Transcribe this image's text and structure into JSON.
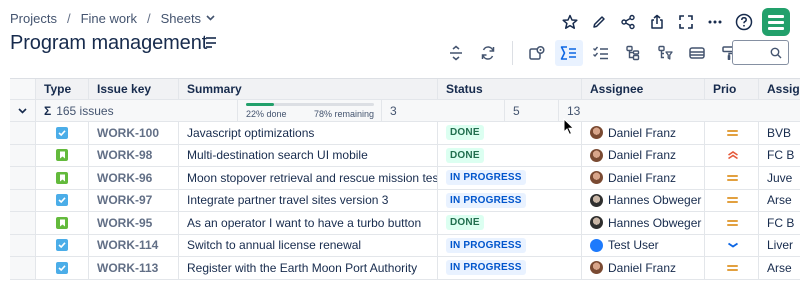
{
  "breadcrumb": {
    "items": [
      "Projects",
      "Fine work",
      "Sheets"
    ]
  },
  "page": {
    "title": "Program management"
  },
  "top_icons": [
    "star-icon",
    "pencil-icon",
    "share-icon",
    "export-icon",
    "fullscreen-icon",
    "more-icon",
    "help-icon",
    "app-logo-icon"
  ],
  "toolbar": {
    "icons": [
      "row-height-icon",
      "refresh-icon",
      "view-icon",
      "sum-icon",
      "checklist-icon",
      "hierarchy-icon",
      "hierarchy-filter-icon",
      "card-icon",
      "format-paint-icon"
    ],
    "search_placeholder": ""
  },
  "table": {
    "columns": [
      "Type",
      "Issue key",
      "Summary",
      "Status",
      "Assignee",
      "Prio",
      "Assig"
    ],
    "summary_row": {
      "count_label": "165 issues",
      "progress_done_label": "22% done",
      "progress_remaining_label": "78% remaining",
      "progress_done_fraction": 0.22,
      "assignee_count": "3",
      "prio_count": "5",
      "assig_count": "13"
    },
    "rows": [
      {
        "type": "task",
        "key": "WORK-100",
        "summary": "Javascript optimizations",
        "status": "DONE",
        "status_kind": "done",
        "assignee": "Daniel Franz",
        "avatar": "daniel",
        "prio": "medium",
        "assig": "BVB"
      },
      {
        "type": "story",
        "key": "WORK-98",
        "summary": "Multi-destination search UI mobile",
        "status": "DONE",
        "status_kind": "done",
        "assignee": "Daniel Franz",
        "avatar": "daniel",
        "prio": "highest",
        "assig": "FC B"
      },
      {
        "type": "story",
        "key": "WORK-96",
        "summary": "Moon stopover retrieval and rescue mission testi...",
        "status": "IN PROGRESS",
        "status_kind": "inprog",
        "assignee": "Daniel Franz",
        "avatar": "daniel",
        "prio": "medium",
        "assig": "Juve"
      },
      {
        "type": "task",
        "key": "WORK-97",
        "summary": "Integrate partner travel sites version 3",
        "status": "IN PROGRESS",
        "status_kind": "inprog",
        "assignee": "Hannes Obweger",
        "avatar": "hannes",
        "prio": "medium",
        "assig": "Arse"
      },
      {
        "type": "story",
        "key": "WORK-95",
        "summary": "As an operator I want to have a turbo button",
        "status": "DONE",
        "status_kind": "done",
        "assignee": "Hannes Obweger",
        "avatar": "hannes",
        "prio": "medium",
        "assig": "FC B"
      },
      {
        "type": "task",
        "key": "WORK-114",
        "summary": "Switch to annual license renewal",
        "status": "IN PROGRESS",
        "status_kind": "inprog",
        "assignee": "Test User",
        "avatar": "test",
        "prio": "low",
        "assig": "Liver"
      },
      {
        "type": "task",
        "key": "WORK-113",
        "summary": "Register with the Earth Moon Port Authority",
        "status": "IN PROGRESS",
        "status_kind": "inprog",
        "assignee": "Daniel Franz",
        "avatar": "daniel",
        "prio": "medium",
        "assig": "Arse"
      }
    ]
  },
  "colors": {
    "done_bg": "#dcfff1",
    "done_text": "#216e4e",
    "inprogress_bg": "#e9f2ff",
    "inprogress_text": "#0055cc",
    "accent_green": "#22a06b",
    "task_blue": "#4bade8",
    "story_green": "#63ba3c",
    "prio_medium": "#e2a03f",
    "prio_highest": "#e55a3b",
    "prio_low": "#0c66e4"
  }
}
